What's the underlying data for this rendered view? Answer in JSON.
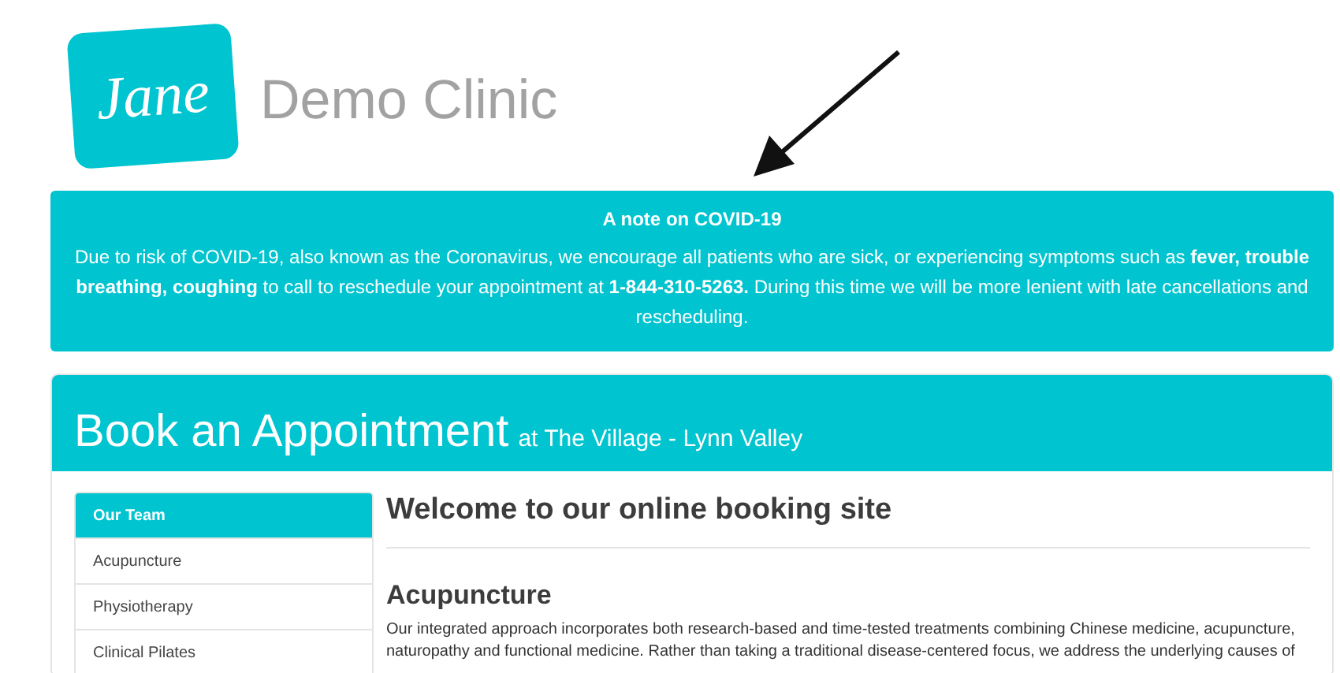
{
  "header": {
    "logo": "Jane",
    "clinic_name": "Demo Clinic"
  },
  "notice": {
    "title": "A note on COVID-19",
    "body": "Due to risk of COVID-19, also known as the Coronavirus, we encourage all patients who are sick, or experiencing symptoms such as **fever, trouble breathing, coughing** to call to reschedule your appointment at **1-844-310-5263.** During this time we will be more lenient with late cancellations and rescheduling."
  },
  "booking": {
    "title": "Book an Appointment",
    "location": "at The Village - Lynn Valley",
    "sidebar": {
      "items": [
        {
          "label": "Our Team",
          "selected": true
        },
        {
          "label": "Acupuncture",
          "selected": false
        },
        {
          "label": "Physiotherapy",
          "selected": false
        },
        {
          "label": "Clinical Pilates",
          "selected": false
        }
      ]
    },
    "content": {
      "heading": "Welcome to our online booking site",
      "section_title": "Acupuncture",
      "paragraph": "Our integrated approach incorporates both research-based and time-tested treatments combining Chinese medicine, acupuncture, naturopathy and functional medicine. Rather than taking a traditional disease-centered focus, we address the underlying causes of"
    }
  }
}
